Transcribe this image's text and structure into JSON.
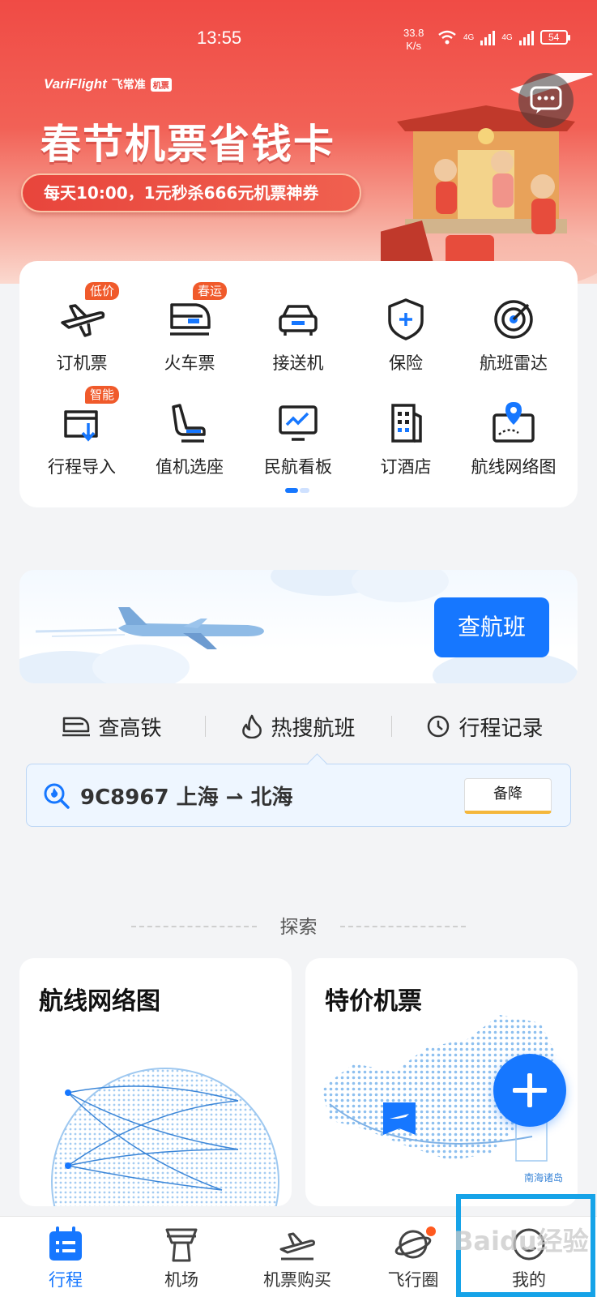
{
  "status_bar": {
    "time": "13:55",
    "speed_value": "33.8",
    "speed_unit": "K/s",
    "network_1": "4G",
    "network_2": "4G",
    "battery": "54"
  },
  "banner": {
    "brand_en": "VariFlight",
    "brand_cn": "飞常准",
    "brand_tag": "机票",
    "title": "春节机票省钱卡",
    "subtitle": "每天10:00，1元秒杀666元机票神券",
    "chat_icon": "chat-bubble-icon"
  },
  "services": [
    {
      "label": "订机票",
      "badge": "低价",
      "icon": "plane-icon"
    },
    {
      "label": "火车票",
      "badge": "春运",
      "icon": "train-icon"
    },
    {
      "label": "接送机",
      "badge": "",
      "icon": "car-icon"
    },
    {
      "label": "保险",
      "badge": "",
      "icon": "shield-icon"
    },
    {
      "label": "航班雷达",
      "badge": "",
      "icon": "radar-icon"
    },
    {
      "label": "行程导入",
      "badge": "智能",
      "icon": "import-icon"
    },
    {
      "label": "值机选座",
      "badge": "",
      "icon": "seat-icon"
    },
    {
      "label": "民航看板",
      "badge": "",
      "icon": "dashboard-icon"
    },
    {
      "label": "订酒店",
      "badge": "",
      "icon": "hotel-icon"
    },
    {
      "label": "航线网络图",
      "badge": "",
      "icon": "route-map-icon"
    }
  ],
  "search": {
    "button_label": "查航班",
    "quick_links": [
      {
        "label": "查高铁",
        "icon": "train-icon"
      },
      {
        "label": "热搜航班",
        "icon": "fire-icon"
      },
      {
        "label": "行程记录",
        "icon": "clock-icon"
      }
    ],
    "hot_flight": {
      "text": "9C8967 上海 ⇀ 北海",
      "button": "备降"
    }
  },
  "explore": {
    "heading": "探索",
    "cards": [
      {
        "title": "航线网络图"
      },
      {
        "title": "特价机票",
        "map_caption": "南海诸岛"
      }
    ]
  },
  "tabbar": {
    "tabs": [
      {
        "label": "行程",
        "icon": "itinerary-icon",
        "active": true
      },
      {
        "label": "机场",
        "icon": "airport-tower-icon",
        "active": false
      },
      {
        "label": "机票购买",
        "icon": "plane-ticket-icon",
        "active": false
      },
      {
        "label": "飞行圈",
        "icon": "planet-icon",
        "active": false
      },
      {
        "label": "我的",
        "icon": "profile-icon",
        "active": false
      }
    ]
  },
  "watermark": "Baidu经验",
  "colors": {
    "primary": "#1677ff",
    "banner_red": "#f04b45",
    "badge_orange": "#f05a2b",
    "highlight": "#16a3e8"
  }
}
